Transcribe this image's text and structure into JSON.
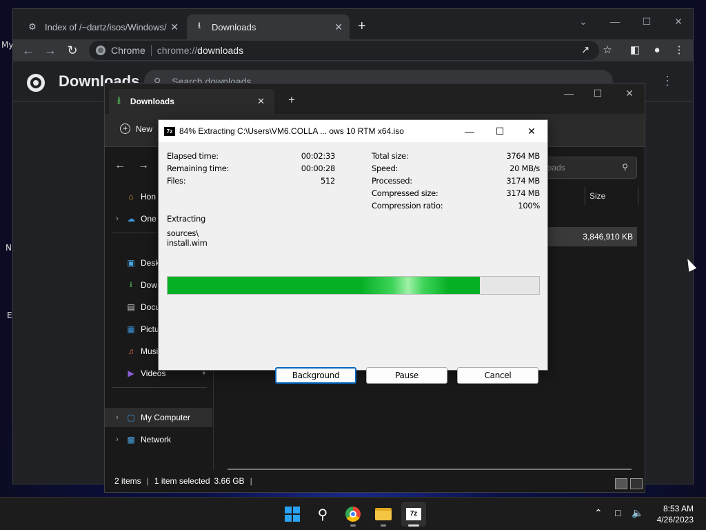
{
  "desktop": {
    "labels": [
      "My",
      "N",
      "E"
    ]
  },
  "chrome": {
    "tabs": [
      {
        "title": "Index of /~dartz/isos/Windows/",
        "icon": "page-icon"
      },
      {
        "title": "Downloads",
        "icon": "download-icon"
      }
    ],
    "omnibox": {
      "chip": "Chrome",
      "scheme": "chrome://",
      "host": "downloads"
    },
    "page_title": "Downloads",
    "search_placeholder": "Search downloads"
  },
  "explorer": {
    "tab_title": "Downloads",
    "new_label": "New",
    "search_placeholder": "loads",
    "column_size": "Size",
    "file_size": "3,846,910 KB",
    "sidebar": [
      {
        "label": "Hon",
        "icon": "home-icon"
      },
      {
        "label": "One",
        "icon": "onedrive-icon"
      },
      {
        "label": "Desk",
        "icon": "desktop-icon"
      },
      {
        "label": "Dow",
        "icon": "downloads-icon"
      },
      {
        "label": "Docu",
        "icon": "documents-icon"
      },
      {
        "label": "Pictu",
        "icon": "pictures-icon"
      },
      {
        "label": "Musi",
        "icon": "music-icon"
      },
      {
        "label": "Videos",
        "icon": "videos-icon"
      },
      {
        "label": "My Computer",
        "icon": "computer-icon"
      },
      {
        "label": "Network",
        "icon": "network-icon"
      }
    ],
    "status": {
      "items": "2 items",
      "selected": "1 item selected",
      "size": "3.66 GB"
    }
  },
  "sevenzip": {
    "logo": "7z",
    "title": "84% Extracting C:\\Users\\VM6.COLLA ... ows 10 RTM x64.iso",
    "left_stats": [
      {
        "label": "Elapsed time:",
        "value": "00:02:33"
      },
      {
        "label": "Remaining time:",
        "value": "00:00:28"
      },
      {
        "label": "Files:",
        "value": "512"
      }
    ],
    "right_stats": [
      {
        "label": "Total size:",
        "value": "3764 MB"
      },
      {
        "label": "Speed:",
        "value": "20 MB/s"
      },
      {
        "label": "Processed:",
        "value": "3174 MB"
      },
      {
        "label": "Compressed size:",
        "value": "3174 MB"
      },
      {
        "label": "Compression ratio:",
        "value": "100%"
      }
    ],
    "operation": "Extracting",
    "current_path": "sources\\",
    "current_file": "install.wim",
    "progress": 0.84,
    "buttons": {
      "background": "Background",
      "pause": "Pause",
      "cancel": "Cancel"
    }
  },
  "taskbar": {
    "time": "8:53 AM",
    "date": "4/26/2023"
  },
  "colors": {
    "progress": "#06b025",
    "accent": "#0067c0",
    "chrome_bg": "#202124"
  }
}
